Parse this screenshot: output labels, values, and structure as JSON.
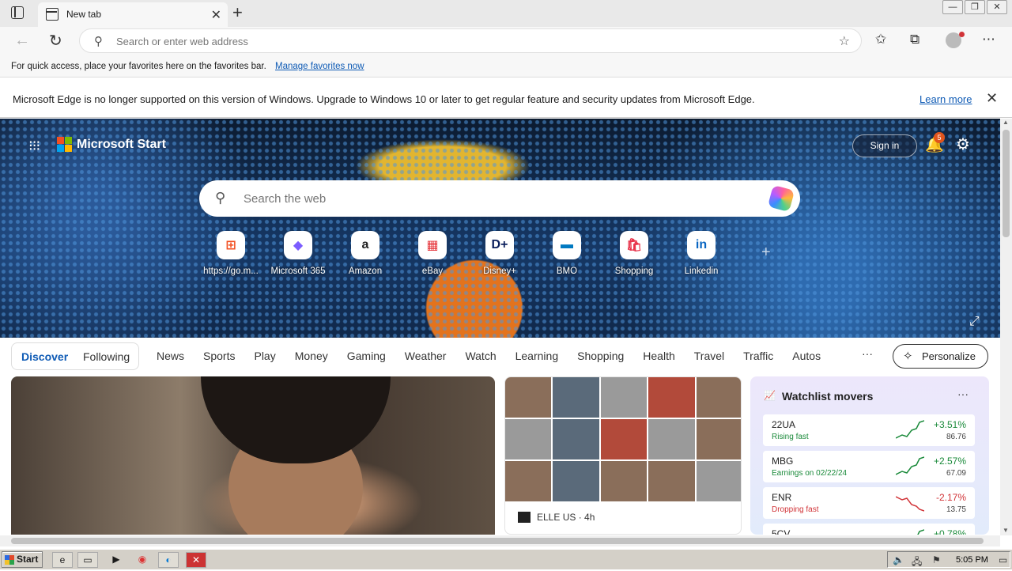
{
  "browser": {
    "tab_title": "New tab",
    "address_placeholder": "Search or enter web address",
    "favorites_hint": "For quick access, place your favorites here on the favorites bar.",
    "favorites_link": "Manage favorites now",
    "info_message": "Microsoft Edge is no longer supported on this version of Windows. Upgrade to Windows 10 or later to get regular feature and security updates from Microsoft Edge.",
    "info_link": "Learn more"
  },
  "start_page": {
    "brand": "Microsoft Start",
    "sign_in": "Sign in",
    "notification_count": "5",
    "search_placeholder": "Search the web",
    "quick_links": [
      {
        "label": "https://go.m...",
        "icon": "windows-icon",
        "glyph": "⊞",
        "color": "#f25022"
      },
      {
        "label": "Microsoft 365",
        "icon": "m365-icon",
        "glyph": "◆",
        "color": "#7b5cff"
      },
      {
        "label": "Amazon",
        "icon": "amazon-icon",
        "glyph": "a",
        "color": "#222222"
      },
      {
        "label": "eBay",
        "icon": "ebay-icon",
        "glyph": "▦",
        "color": "#e53238"
      },
      {
        "label": "Disney+",
        "icon": "disney-icon",
        "glyph": "D+",
        "color": "#0b1f5c"
      },
      {
        "label": "BMO",
        "icon": "bmo-icon",
        "glyph": "▬",
        "color": "#0079c1"
      },
      {
        "label": "Shopping",
        "icon": "shopping-bag-icon",
        "glyph": "🛍",
        "color": "#e8324a"
      },
      {
        "label": "Linkedin",
        "icon": "linkedin-icon",
        "glyph": "in",
        "color": "#0a66c2"
      }
    ],
    "nav": {
      "discover": "Discover",
      "following": "Following",
      "categories": [
        "News",
        "Sports",
        "Play",
        "Money",
        "Gaming",
        "Weather",
        "Watch",
        "Learning",
        "Shopping",
        "Health",
        "Travel",
        "Traffic",
        "Autos"
      ],
      "more": "···",
      "personalize": "Personalize"
    },
    "feed": {
      "mid_source": "ELLE US · 4h"
    },
    "watchlist": {
      "title": "Watchlist movers",
      "rows": [
        {
          "symbol": "22UA",
          "sub": "Rising fast",
          "change": "+3.51%",
          "price": "86.76",
          "trend": "up"
        },
        {
          "symbol": "MBG",
          "sub": "Earnings on 02/22/24",
          "change": "+2.57%",
          "price": "67.09",
          "trend": "up"
        },
        {
          "symbol": "ENR",
          "sub": "Dropping fast",
          "change": "-2.17%",
          "price": "13.75",
          "trend": "down"
        },
        {
          "symbol": "5CV",
          "sub": "",
          "change": "+0.78%",
          "price": "",
          "trend": "up"
        }
      ]
    }
  },
  "colors": {
    "accent": "#0f5bb5",
    "positive": "#1a8a3a",
    "negative": "#d13438"
  },
  "taskbar": {
    "start": "Start",
    "clock": "5:05 PM"
  }
}
